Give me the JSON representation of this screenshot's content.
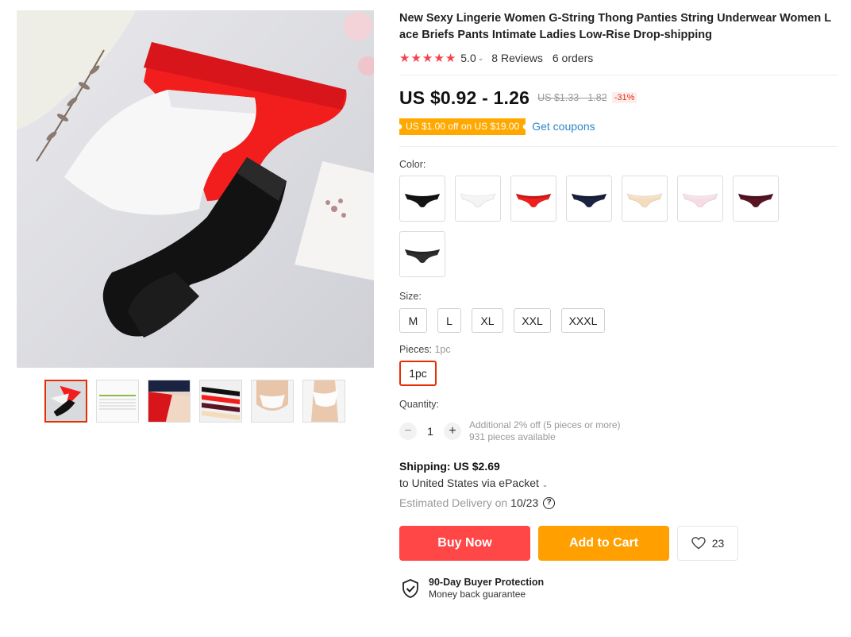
{
  "product": {
    "title": "New Sexy Lingerie Women G-String Thong Panties String Underwear Women Lace Briefs Pants Intimate Ladies Low-Rise Drop-shipping",
    "rating": "5.0",
    "reviews": "8 Reviews",
    "orders": "6 orders",
    "stars": 5
  },
  "price": {
    "current": "US $0.92 - 1.26",
    "original": "US $1.33 - 1.82",
    "discount": "-31%"
  },
  "coupon": {
    "badge": "US $1.00 off on US $19.00",
    "link": "Get coupons"
  },
  "color": {
    "label": "Color:",
    "swatches": [
      {
        "name": "black",
        "hex": "#141414"
      },
      {
        "name": "white",
        "hex": "#f4f4f4"
      },
      {
        "name": "red",
        "hex": "#f21e1e"
      },
      {
        "name": "navy",
        "hex": "#1a2340"
      },
      {
        "name": "nude",
        "hex": "#f3dcbc"
      },
      {
        "name": "pink",
        "hex": "#f6dde4"
      },
      {
        "name": "wine",
        "hex": "#5a1424"
      },
      {
        "name": "dark-gray",
        "hex": "#2e2e2e"
      }
    ]
  },
  "size": {
    "label": "Size:",
    "options": [
      "M",
      "L",
      "XL",
      "XXL",
      "XXXL"
    ]
  },
  "pieces": {
    "label": "Pieces:",
    "selected": "1pc",
    "options": [
      "1pc"
    ]
  },
  "quantity": {
    "label": "Quantity:",
    "minus": "−",
    "plus": "+",
    "value": "1",
    "note": "Additional 2% off (5 pieces or more)",
    "available": "931 pieces available"
  },
  "shipping": {
    "cost": "Shipping: US $2.69",
    "destination": "to United States via ePacket",
    "delivery_label": "Estimated Delivery on",
    "delivery_date": "10/23"
  },
  "actions": {
    "buy_now": "Buy Now",
    "add_to_cart": "Add to Cart",
    "wishlist_count": "23"
  },
  "protection": {
    "title": "90-Day Buyer Protection",
    "subtitle": "Money back guarantee"
  },
  "colors": {
    "accent": "#ff4747",
    "cart": "#ffa000",
    "link": "#2e87c9",
    "star": "#f5424a"
  }
}
